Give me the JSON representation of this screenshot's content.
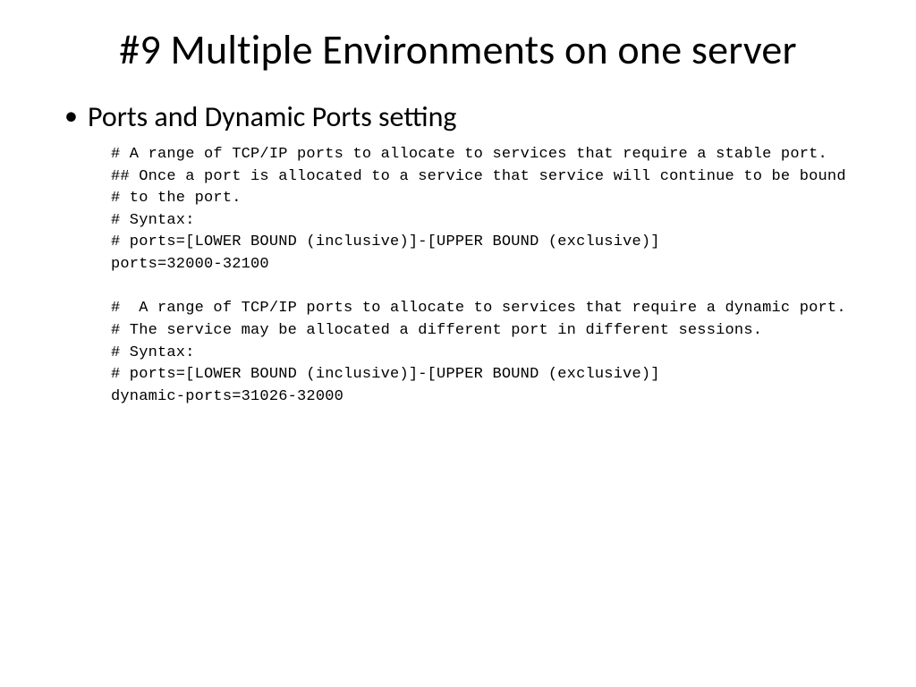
{
  "slide": {
    "title": "#9 Multiple Environments on one server",
    "bullet": "Ports and Dynamic Ports setting",
    "code": "# A range of TCP/IP ports to allocate to services that require a stable port.\n## Once a port is allocated to a service that service will continue to be bound\n# to the port.\n# Syntax:\n# ports=[LOWER BOUND (inclusive)]-[UPPER BOUND (exclusive)]\nports=32000-32100\n\n#  A range of TCP/IP ports to allocate to services that require a dynamic port.\n# The service may be allocated a different port in different sessions.\n# Syntax:\n# ports=[LOWER BOUND (inclusive)]-[UPPER BOUND (exclusive)]\ndynamic-ports=31026-32000"
  }
}
